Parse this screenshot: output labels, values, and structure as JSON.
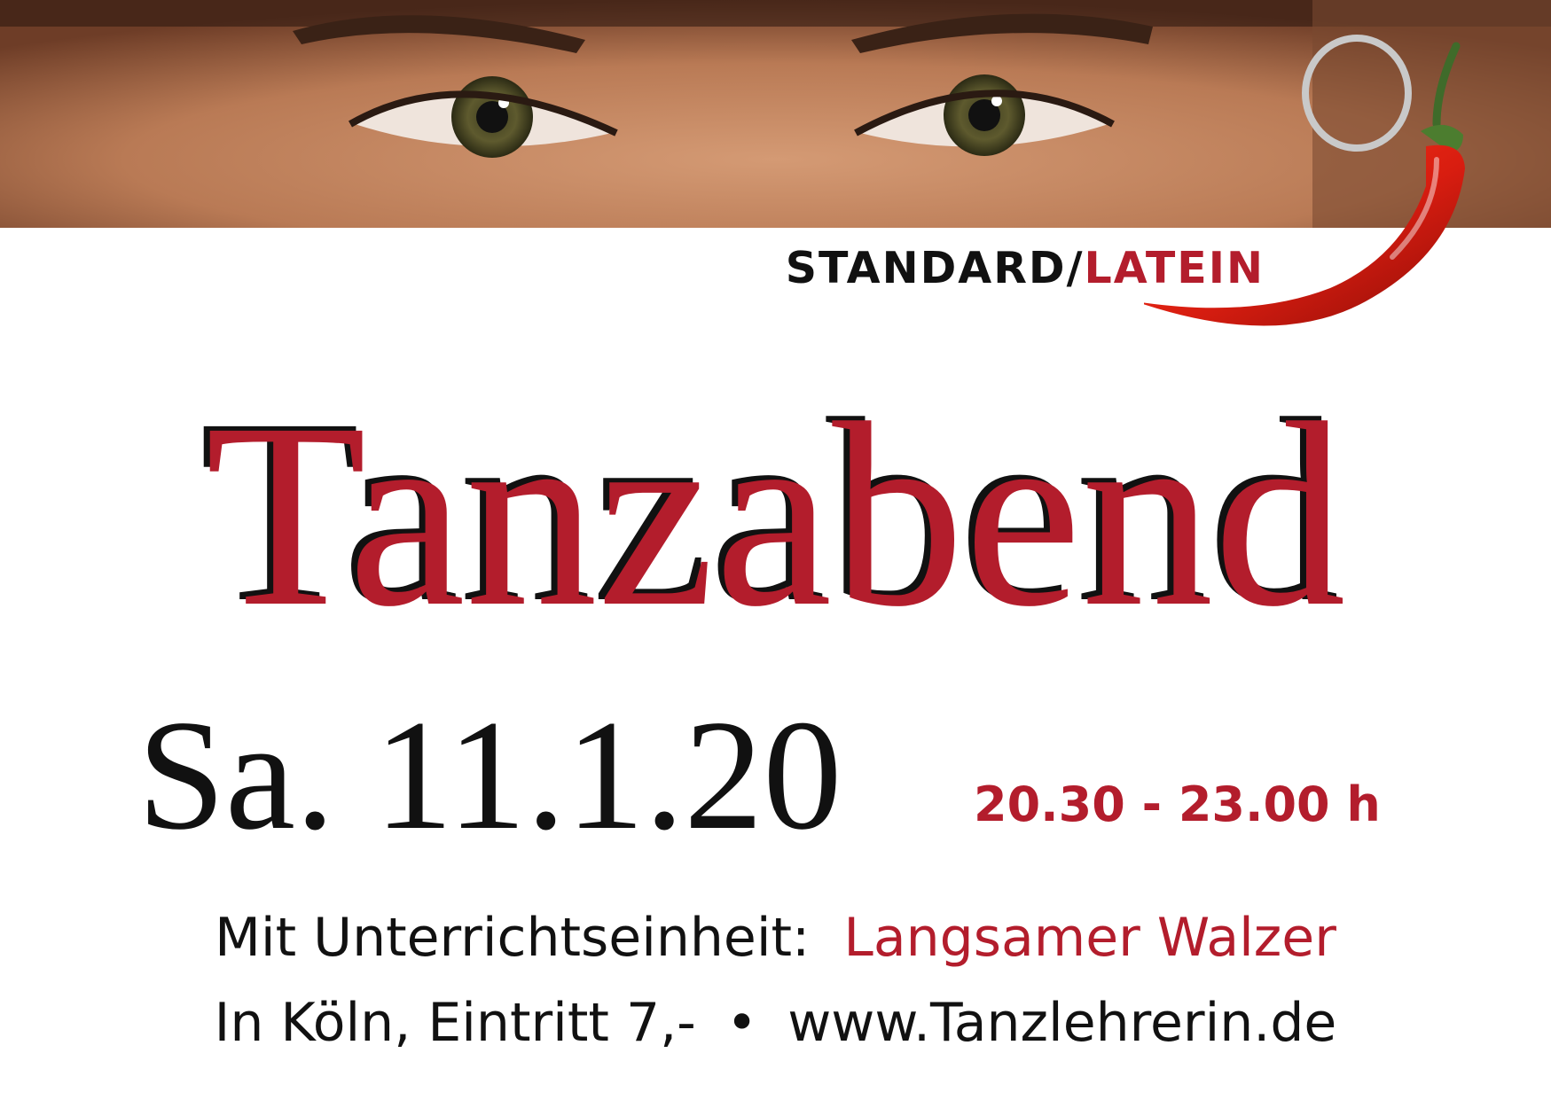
{
  "flyer": {
    "category_standard": "STANDARD/",
    "category_latin": "LATEIN",
    "title": "Tanzabend",
    "date": "Sa. 11.1.20",
    "time": "20.30 - 23.00 h",
    "lesson_label": "Mit Unterrichtseinheit:",
    "lesson_dance": "Langsamer Walzer",
    "location": "In Köln, Eintritt 7,-",
    "separator": "•",
    "website": "www.Tanzlehrerin.de"
  },
  "colors": {
    "accent_red": "#b31d2c",
    "text_black": "#111111",
    "background": "#ffffff"
  },
  "icons": {
    "chili": "chili-pepper-icon"
  }
}
